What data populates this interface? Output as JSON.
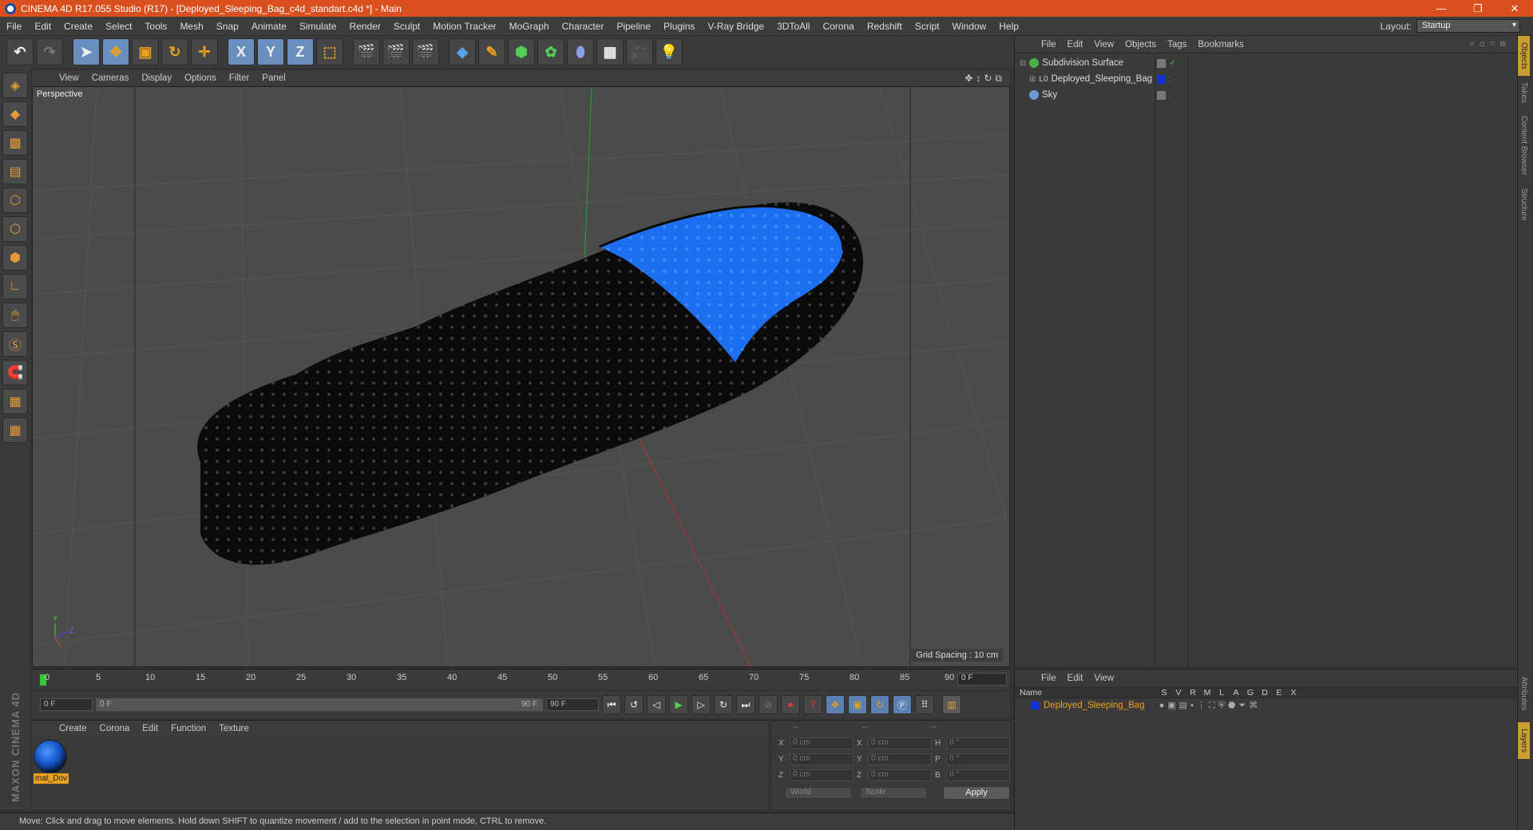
{
  "window": {
    "title": "CINEMA 4D R17.055 Studio (R17) - [Deployed_Sleeping_Bag_c4d_standart.c4d *] - Main",
    "controls": [
      "—",
      "❐",
      "✕"
    ]
  },
  "menubar": {
    "items": [
      "File",
      "Edit",
      "Create",
      "Select",
      "Tools",
      "Mesh",
      "Snap",
      "Animate",
      "Simulate",
      "Render",
      "Sculpt",
      "Motion Tracker",
      "MoGraph",
      "Character",
      "Pipeline",
      "Plugins",
      "V-Ray Bridge",
      "3DToAll",
      "Corona",
      "Redshift",
      "Script",
      "Window",
      "Help"
    ],
    "layout_label": "Layout:",
    "layout_value": "Startup"
  },
  "toolbar": {
    "axis_x": "X",
    "axis_y": "Y",
    "axis_z": "Z"
  },
  "viewport": {
    "menu": [
      "View",
      "Cameras",
      "Display",
      "Options",
      "Filter",
      "Panel"
    ],
    "camera": "Perspective",
    "grid_spacing": "Grid Spacing : 10 cm",
    "colors": {
      "bag_body": "#0b0b0b",
      "bag_lining": "#1e6ff0",
      "grid_bg": "#4b4b4b"
    }
  },
  "timeline": {
    "ticks": [
      "0",
      "5",
      "10",
      "15",
      "20",
      "25",
      "30",
      "35",
      "40",
      "45",
      "50",
      "55",
      "60",
      "65",
      "70",
      "75",
      "80",
      "85",
      "90"
    ],
    "current_frame": "0 F"
  },
  "playback": {
    "start": "0 F",
    "slider_start": "0 F",
    "slider_end": "90 F",
    "end": "90 F"
  },
  "material_manager": {
    "menu": [
      "Create",
      "Corona",
      "Edit",
      "Function",
      "Texture"
    ],
    "materials": [
      {
        "name": "mat_Dov"
      }
    ]
  },
  "coordinates": {
    "header": [
      "--",
      "--",
      "--"
    ],
    "rows": [
      {
        "a": "X",
        "av": "0 cm",
        "b": "X",
        "bv": "0 cm",
        "c": "H",
        "cv": "0 °"
      },
      {
        "a": "Y",
        "av": "0 cm",
        "b": "Y",
        "bv": "0 cm",
        "c": "P",
        "cv": "0 °"
      },
      {
        "a": "Z",
        "av": "0 cm",
        "b": "Z",
        "bv": "0 cm",
        "c": "B",
        "cv": "0 °"
      }
    ],
    "mode": "World",
    "transform": "Scale",
    "apply": "Apply"
  },
  "status": "Move: Click and drag to move elements. Hold down SHIFT to quantize movement / add to the selection in point mode, CTRL to remove.",
  "object_manager": {
    "menu": [
      "File",
      "Edit",
      "View",
      "Objects",
      "Tags",
      "Bookmarks"
    ],
    "objects": [
      {
        "name": "Subdivision Surface",
        "icon_color": "#4ab04a"
      },
      {
        "name": "Deployed_Sleeping_Bag",
        "icon_color": "#cccccc"
      },
      {
        "name": "Sky",
        "icon_color": "#6a9ad0"
      }
    ]
  },
  "side_tabs": [
    "Objects",
    "Takes",
    "Content Browser",
    "Structure"
  ],
  "side_tabs_lower": [
    "Attributes",
    "Layers"
  ],
  "layer_manager": {
    "menu": [
      "File",
      "Edit",
      "View"
    ],
    "columns": [
      "Name",
      "S",
      "V",
      "R",
      "M",
      "L",
      "A",
      "G",
      "D",
      "E",
      "X"
    ],
    "layers": [
      {
        "name": "Deployed_Sleeping_Bag",
        "color": "#1030d0"
      }
    ]
  }
}
